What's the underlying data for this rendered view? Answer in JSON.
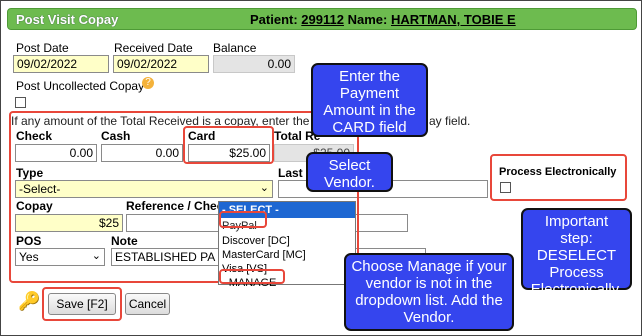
{
  "header": {
    "title": "Post Visit Copay",
    "patient_label": "Patient:",
    "patient_id": "299112",
    "name_label": "Name:",
    "patient_name": "HARTMAN, TOBIE E"
  },
  "dates": {
    "post_date_label": "Post Date",
    "post_date_value": "09/02/2022",
    "received_date_label": "Received Date",
    "received_date_value": "09/02/2022",
    "balance_label": "Balance",
    "balance_value": "0.00"
  },
  "uncollected": {
    "label": "Post Uncollected Copay",
    "help_icon": "?"
  },
  "notice_text_left": "If any amount of the Total Received is a copay, ",
  "notice_text_mid": "enter the",
  "notice_text_right": "ay field.",
  "amounts": {
    "check_label": "Check",
    "check_value": "0.00",
    "cash_label": "Cash",
    "cash_value": "0.00",
    "card_label": "Card",
    "card_value": "$25.00",
    "total_label": "Total Re",
    "total_value": "$25.00"
  },
  "type": {
    "label": "Type",
    "selected": "-Select-",
    "last_label": "Last"
  },
  "dropdown_options": [
    "- SELECT -",
    "PayPal",
    "Discover [DC]",
    "MasterCard [MC]",
    "Visa [VS]",
    "- MANAGE -"
  ],
  "process": {
    "label": "Process Electronically"
  },
  "copay": {
    "label": "Copay",
    "value": "$25",
    "reference_label": "Reference / Check"
  },
  "pos": {
    "label": "POS",
    "selected": "Yes",
    "note_label": "Note",
    "note_value": "ESTABLISHED PA"
  },
  "buttons": {
    "save": "Save [F2]",
    "cancel": "Cancel"
  },
  "callouts": {
    "card": "Enter the Payment Amount in the CARD field",
    "vendor": "Select Vendor.",
    "deselect": "Important step: DESELECT Process Electronically.",
    "manage": "Choose Manage if your vendor is not in the dropdown list. Add the Vendor."
  },
  "colors": {
    "title_bar": "#6dbb4f",
    "callout_bg": "#3545ee",
    "highlight_border": "#e8473a",
    "input_yellow": "#ffffc8"
  }
}
